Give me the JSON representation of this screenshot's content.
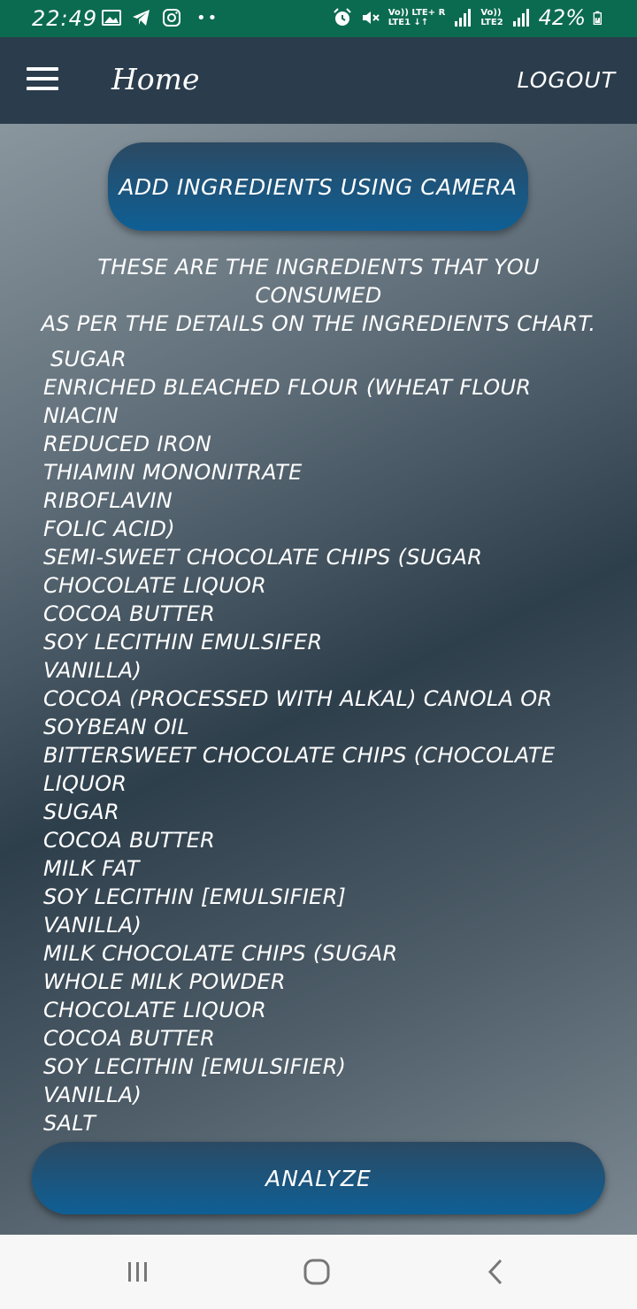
{
  "status_bar": {
    "time": "22:49",
    "left_icons": [
      "image-icon",
      "telegram-icon",
      "instagram-icon"
    ],
    "dots": "••",
    "net1_top": "Vo)) LTE+ R",
    "net1_bottom": "LTE1 ↓↑",
    "net2_top": "Vo))",
    "net2_bottom": "LTE2",
    "battery": "42%",
    "right_icons": [
      "alarm-icon",
      "mute-icon",
      "signal-icon",
      "battery-icon"
    ]
  },
  "app_bar": {
    "title": "Home",
    "logout_label": "LOGOUT"
  },
  "main": {
    "camera_button_label": "ADD INGREDIENTS USING CAMERA",
    "intro_line1": "THESE ARE THE INGREDIENTS THAT YOU CONSUMED",
    "intro_line2": "AS PER THE DETAILS ON THE INGREDIENTS CHART.",
    "ingredients": [
      "SUGAR",
      "ENRICHED BLEACHED FLOUR (WHEAT FLOUR",
      "NIACIN",
      "REDUCED IRON",
      "THIAMIN MONONITRATE",
      "RIBOFLAVIN",
      "FOLIC ACID)",
      "SEMI-SWEET CHOCOLATE CHIPS (SUGAR",
      "CHOCOLATE LIQUOR",
      "COCOA BUTTER",
      "SOY LECITHIN EMULSIFER",
      "VANILLA)",
      "COCOA (PROCESSED WITH ALKAL) CANOLA OR",
      "SOYBEAN OIL",
      "BITTERSWEET CHOCOLATE CHIPS (CHOCOLATE",
      "LIQUOR",
      "SUGAR",
      "COCOA BUTTER",
      "MILK FAT",
      "SOY LECITHIN [EMULSIFIER]",
      "VANILLA)",
      "MILK CHOCOLATE CHIPS (SUGAR",
      "WHOLE MILK POWDER",
      "CHOCOLATE LIQUOR",
      "COCOA BUTTER",
      "SOY LECITHIN [EMULSIFIER)",
      "VANILLA)",
      "SALT"
    ],
    "analyze_label": "ANALYZE"
  },
  "nav_bar": {
    "recents_icon": "recents-icon",
    "home_icon": "home-icon",
    "back_icon": "back-icon"
  },
  "colors": {
    "status_bar": "#0b6b50",
    "app_bar": "#2b3d4c",
    "button_top": "#2b4a63",
    "button_bottom": "#0e5f95",
    "nav_bar": "#f7f7f7"
  }
}
